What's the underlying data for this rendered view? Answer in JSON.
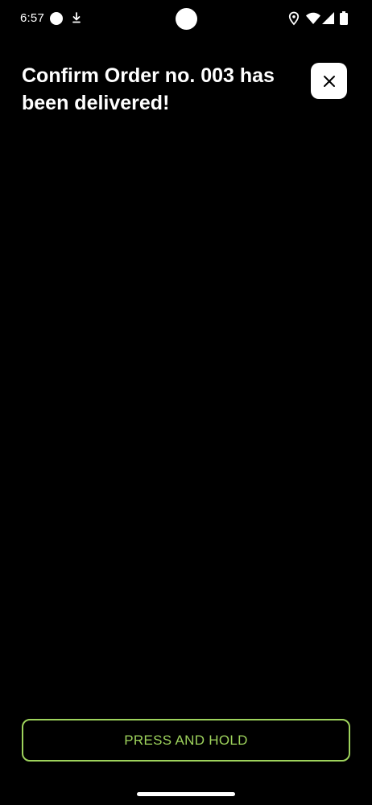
{
  "status_bar": {
    "time": "6:57",
    "icons": [
      "notification-dot-icon",
      "download-icon",
      "location-icon",
      "wifi-icon",
      "cell-signal-icon",
      "battery-icon"
    ]
  },
  "header": {
    "title": "Confirm Order no. 003 has been delivered!",
    "close_icon": "close-icon"
  },
  "actions": {
    "hold_label": "PRESS AND HOLD"
  },
  "colors": {
    "background": "#000000",
    "text": "#ffffff",
    "accent": "#9ed35c",
    "close_button_bg": "#ffffff"
  }
}
